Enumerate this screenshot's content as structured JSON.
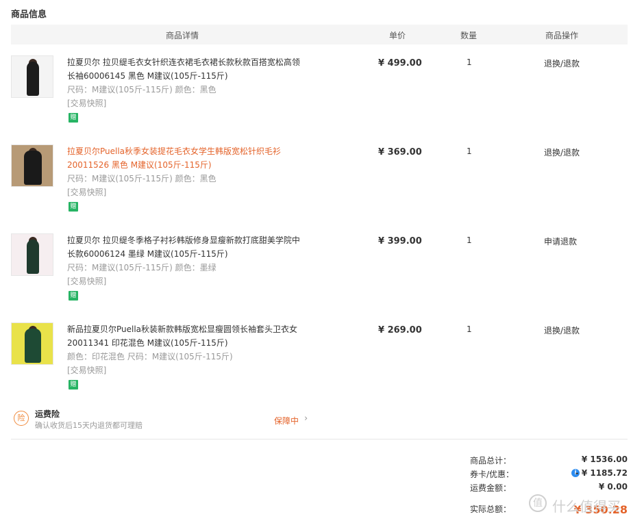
{
  "section_title": "商品信息",
  "table_header": {
    "detail": "商品详情",
    "price": "单价",
    "qty": "数量",
    "ops": "商品操作"
  },
  "items": [
    {
      "title": "拉夏贝尔 拉贝缇毛衣女针织连衣裙毛衣裙长款秋款百搭宽松高领长袖60006145 黑色 M建议(105斤-115斤)",
      "sku": "尺码：M建议(105斤-115斤)   颜色：黑色",
      "snapshot": "[交易快照]",
      "gift": "赠",
      "price": "¥ 499.00",
      "qty": "1",
      "op": "退换/退款",
      "highlight": false
    },
    {
      "title": "拉夏贝尔Puella秋季女装提花毛衣女学生韩版宽松针织毛衫20011526 黑色 M建议(105斤-115斤)",
      "sku": "尺码：M建议(105斤-115斤)   颜色：黑色",
      "snapshot": "[交易快照]",
      "gift": "赠",
      "price": "¥ 369.00",
      "qty": "1",
      "op": "退换/退款",
      "highlight": true
    },
    {
      "title": "拉夏贝尔 拉贝缇冬季格子衬衫韩版修身显瘦新款打底甜美学院中长款60006124 墨绿 M建议(105斤-115斤)",
      "sku": "尺码：M建议(105斤-115斤)   颜色：墨绿",
      "snapshot": "[交易快照]",
      "gift": "赠",
      "price": "¥ 399.00",
      "qty": "1",
      "op": "申请退款",
      "highlight": false
    },
    {
      "title": "新品拉夏贝尔Puella秋装新款韩版宽松显瘦圆领长袖套头卫衣女20011341 印花混色 M建议(105斤-115斤)",
      "sku": "颜色：印花混色   尺码：M建议(105斤-115斤)",
      "snapshot": "[交易快照]",
      "gift": "赠",
      "price": "¥ 269.00",
      "qty": "1",
      "op": "退换/退款",
      "highlight": false
    }
  ],
  "insurance": {
    "icon": "险",
    "title": "运费险",
    "desc": "确认收货后15天内退货都可理赔",
    "status": "保障中",
    "chevron": "›"
  },
  "summary": {
    "goods_total_label": "商品总计：",
    "goods_total": "¥ 1536.00",
    "coupon_label": "券卡/优惠：",
    "coupon": "- ¥ 1185.72",
    "shipping_label": "运费金额：",
    "shipping": "¥  0.00",
    "paid_label": "实际总额：",
    "paid": "¥ 350.28"
  },
  "watermark": {
    "icon": "值",
    "text": "什么值得买"
  }
}
